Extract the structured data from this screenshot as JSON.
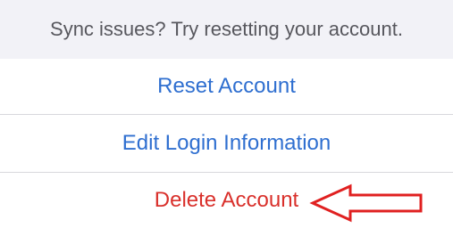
{
  "footer": {
    "text": "Sync issues? Try resetting your account."
  },
  "actions": {
    "reset_label": "Reset Account",
    "edit_label": "Edit Login Information",
    "delete_label": "Delete Account"
  },
  "annotation": {
    "icon": "left-arrow-outline-icon",
    "color": "#e02020"
  },
  "colors": {
    "action_blue": "#2f6fd0",
    "destructive_red": "#d9302b",
    "footer_background": "#f2f2f7"
  }
}
